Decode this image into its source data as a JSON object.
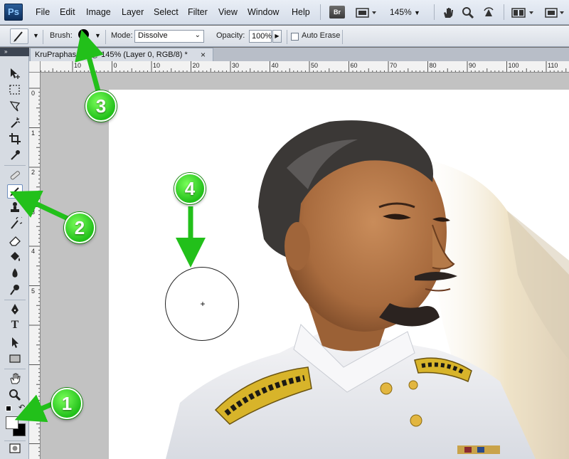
{
  "app": {
    "logo": "Ps"
  },
  "menu": {
    "items": [
      "File",
      "Edit",
      "Image",
      "Layer",
      "Select",
      "Filter",
      "View",
      "Window",
      "Help"
    ]
  },
  "appbar": {
    "bridge_label": "Br",
    "zoom_value": "145%"
  },
  "options": {
    "brush_label": "Brush:",
    "mode_label": "Mode:",
    "mode_value": "Dissolve",
    "opacity_label": "Opacity:",
    "opacity_value": "100%",
    "auto_erase_label": "Auto Erase"
  },
  "document": {
    "tab_title": "KruPraphas.jpg @ 145% (Layer 0, RGB/8) *",
    "close_glyph": "×"
  },
  "ruler": {
    "top_labels": [
      "10",
      "0",
      "10",
      "20",
      "30",
      "40",
      "50",
      "60",
      "70",
      "80",
      "90",
      "100",
      "110"
    ],
    "left_labels": [
      "0",
      "1",
      "2",
      "3",
      "4",
      "5"
    ]
  },
  "annotations": [
    "1",
    "2",
    "3",
    "4"
  ],
  "icons": {
    "tools": [
      "move-icon",
      "marquee-icon",
      "lasso-icon",
      "magic-wand-icon",
      "crop-icon",
      "eyedropper-icon",
      "healing-brush-icon",
      "pencil-icon",
      "clone-stamp-icon",
      "history-brush-icon",
      "eraser-icon",
      "paint-bucket-icon",
      "blur-icon",
      "dodge-icon",
      "pen-icon",
      "type-icon",
      "path-selection-icon",
      "rectangle-icon",
      "hand-icon",
      "zoom-icon"
    ]
  },
  "colors": {
    "annotation_green": "#22c01a",
    "foreground": "#ffffff",
    "background": "#000000"
  }
}
